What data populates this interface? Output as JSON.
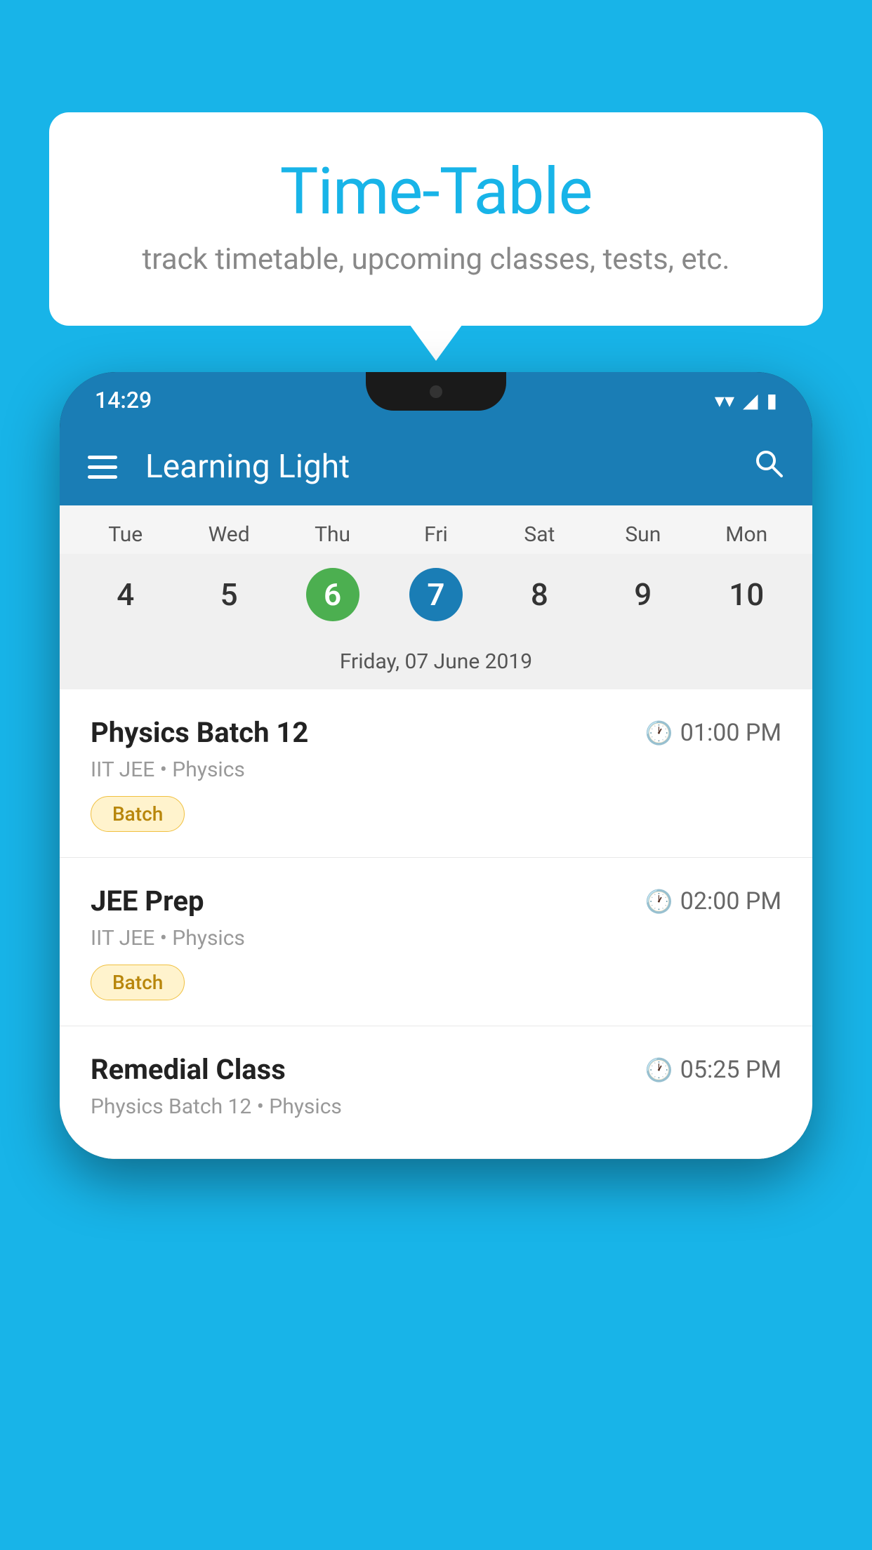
{
  "background": {
    "color": "#18B4E8"
  },
  "bubble": {
    "title": "Time-Table",
    "subtitle": "track timetable, upcoming classes, tests, etc."
  },
  "status_bar": {
    "time": "14:29"
  },
  "toolbar": {
    "title": "Learning Light"
  },
  "calendar": {
    "days": [
      "Tue",
      "Wed",
      "Thu",
      "Fri",
      "Sat",
      "Sun",
      "Mon"
    ],
    "dates": [
      {
        "num": "4",
        "state": "normal"
      },
      {
        "num": "5",
        "state": "normal"
      },
      {
        "num": "6",
        "state": "today"
      },
      {
        "num": "7",
        "state": "selected"
      },
      {
        "num": "8",
        "state": "normal"
      },
      {
        "num": "9",
        "state": "normal"
      },
      {
        "num": "10",
        "state": "normal"
      }
    ],
    "selected_label": "Friday, 07 June 2019"
  },
  "classes": [
    {
      "name": "Physics Batch 12",
      "time": "01:00 PM",
      "meta": "IIT JEE • Physics",
      "tag": "Batch"
    },
    {
      "name": "JEE Prep",
      "time": "02:00 PM",
      "meta": "IIT JEE • Physics",
      "tag": "Batch"
    },
    {
      "name": "Remedial Class",
      "time": "05:25 PM",
      "meta": "Physics Batch 12 • Physics",
      "tag": ""
    }
  ]
}
